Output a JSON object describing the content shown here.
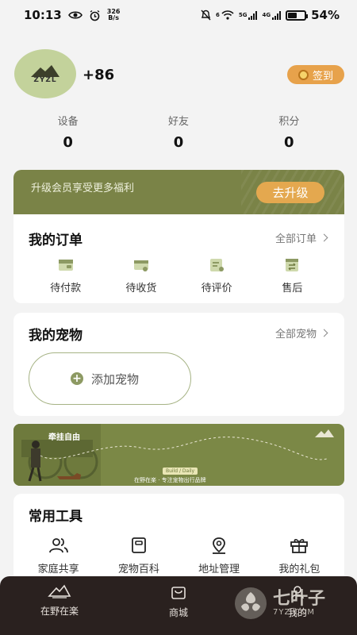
{
  "status_bar": {
    "time": "10:13",
    "net_speed_value": "326",
    "net_speed_unit": "B/s",
    "battery_text": "54%",
    "battery_level": 0.54,
    "net_5g": "5G",
    "net_4g": "4G",
    "wifi_tag": "6"
  },
  "profile": {
    "avatar_brand": "ZYZL",
    "phone": "+86",
    "signin_label": "签到"
  },
  "stats": [
    {
      "label": "设备",
      "value": "0"
    },
    {
      "label": "好友",
      "value": "0"
    },
    {
      "label": "积分",
      "value": "0"
    }
  ],
  "upgrade": {
    "text": "升级会员享受更多福利",
    "button": "去升级"
  },
  "orders": {
    "title": "我的订单",
    "more": "全部订单",
    "items": [
      {
        "label": "待付款",
        "icon": "wallet-icon"
      },
      {
        "label": "待收货",
        "icon": "delivery-truck-icon"
      },
      {
        "label": "待评价",
        "icon": "review-note-icon"
      },
      {
        "label": "售后",
        "icon": "exchange-icon"
      }
    ]
  },
  "pets": {
    "title": "我的宠物",
    "more": "全部宠物",
    "add_label": "添加宠物"
  },
  "promo": {
    "title": "牵挂自由",
    "tag": "Build / Daily",
    "subtitle": "在野在楽 · 专注宠物出行品牌"
  },
  "tools": {
    "title": "常用工具",
    "items": [
      {
        "label": "家庭共享",
        "icon": "users-icon"
      },
      {
        "label": "宠物百科",
        "icon": "book-icon"
      },
      {
        "label": "地址管理",
        "icon": "location-pin-icon"
      },
      {
        "label": "我的礼包",
        "icon": "gift-icon"
      }
    ]
  },
  "bottom_nav": [
    {
      "label": "在野在楽",
      "icon": "brand-mountain-icon"
    },
    {
      "label": "商城",
      "icon": "shopping-bag-icon"
    },
    {
      "label": "我的",
      "icon": "profile-icon"
    }
  ],
  "watermark": {
    "text": "七叶子",
    "sub": "7YZ.COM"
  },
  "colors": {
    "olive": "#7a8347",
    "orange": "#e7a24b",
    "nav_bg": "#2a211f"
  }
}
